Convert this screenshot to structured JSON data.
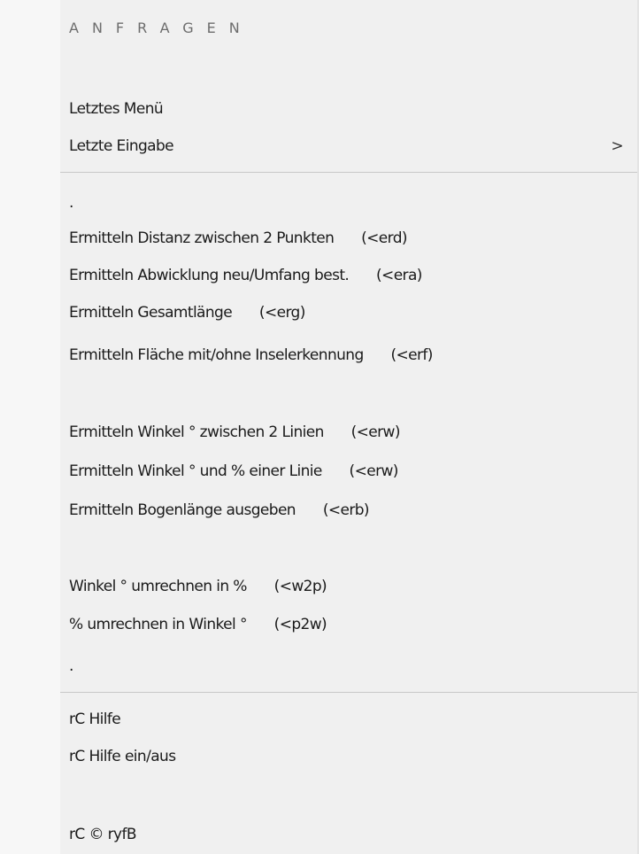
{
  "menu": {
    "header": "ANFRAGEN",
    "group1": [
      {
        "label": "Letztes Menü"
      },
      {
        "label": "Letzte Eingabe",
        "submenu_icon": "chevron-right-icon",
        "submenu_glyph": ">"
      }
    ],
    "group2": [
      {
        "label": "."
      },
      {
        "label": "Ermitteln Distanz zwischen 2 Punkten",
        "shortcut": "(<erd)"
      },
      {
        "label": "Ermitteln Abwicklung neu/Umfang best.",
        "shortcut": "(<era)"
      },
      {
        "label": "Ermitteln Gesamtlänge",
        "shortcut": "(<erg)"
      },
      {
        "label": "Ermitteln Fläche mit/ohne Inselerkennung",
        "shortcut": "(<erf)"
      },
      {
        "label": "Ermitteln Winkel ° zwischen 2 Linien",
        "shortcut": "(<erw)"
      },
      {
        "label": "Ermitteln Winkel ° und % einer Linie",
        "shortcut": "(<erw)"
      },
      {
        "label": "Ermitteln Bogenlänge ausgeben",
        "shortcut": "(<erb)"
      },
      {
        "label": "Winkel ° umrechnen in %",
        "shortcut": "(<w2p)"
      },
      {
        "label": "% umrechnen in Winkel °",
        "shortcut": "(<p2w)"
      },
      {
        "label": "."
      }
    ],
    "group3": [
      {
        "label": "rC Hilfe"
      },
      {
        "label": "rC Hilfe ein/aus"
      },
      {
        "label": "rC © ryfB"
      }
    ]
  },
  "colors": {
    "background": "#f0f0f0",
    "gutter": "#f7f7f7",
    "separator": "#c8c8c8",
    "header_text": "#6d6d6d",
    "text": "#1a1a1a"
  }
}
